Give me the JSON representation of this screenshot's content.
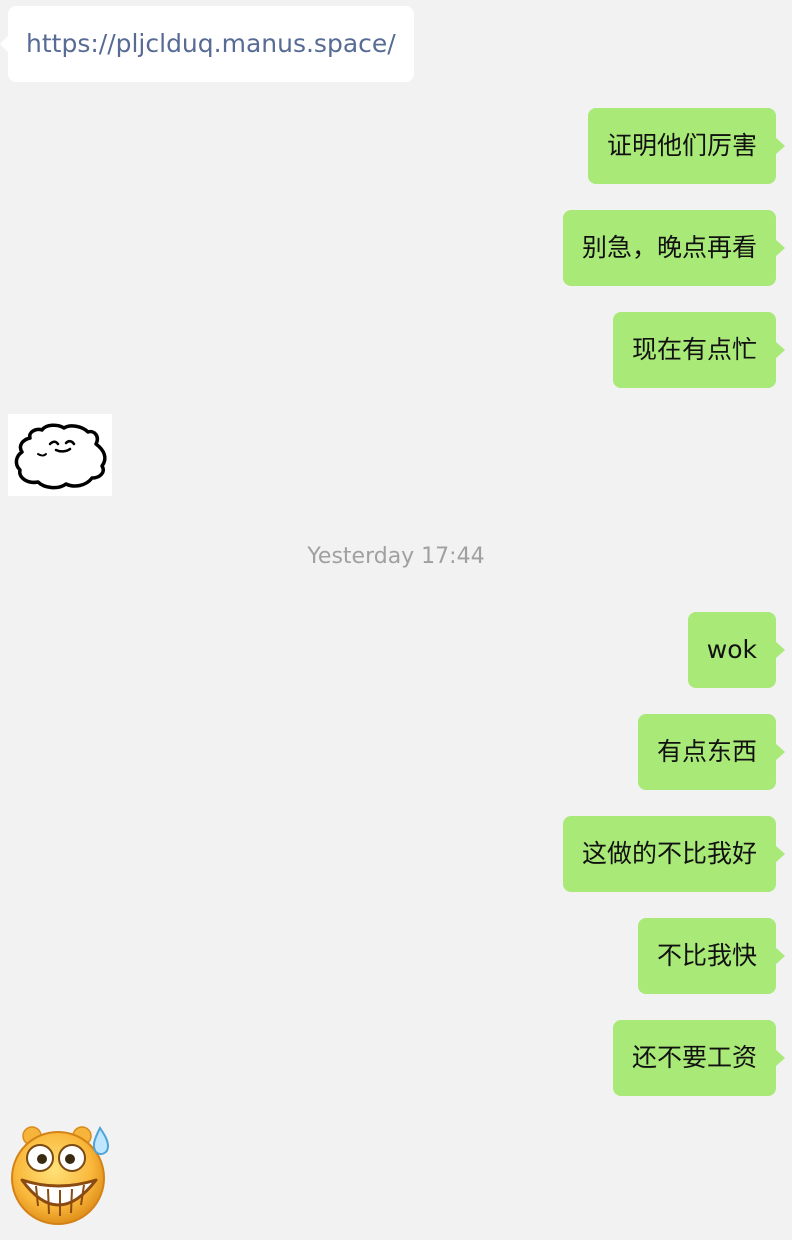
{
  "messages": [
    {
      "side": "in",
      "type": "link",
      "text": "https://pljclduq.manus.space/"
    },
    {
      "side": "out",
      "type": "text",
      "text": "证明他们厉害"
    },
    {
      "side": "out",
      "type": "text",
      "text": "别急，晚点再看"
    },
    {
      "side": "out",
      "type": "text",
      "text": "现在有点忙"
    },
    {
      "side": "in",
      "type": "sticker",
      "icon": "blob-sticker-icon"
    },
    {
      "type": "timestamp",
      "text": "Yesterday 17:44"
    },
    {
      "side": "out",
      "type": "text",
      "text": "wok"
    },
    {
      "side": "out",
      "type": "text",
      "text": "有点东西"
    },
    {
      "side": "out",
      "type": "text",
      "text": "这做的不比我好"
    },
    {
      "side": "out",
      "type": "text",
      "text": "不比我快"
    },
    {
      "side": "out",
      "type": "text",
      "text": "还不要工资"
    },
    {
      "side": "in",
      "type": "sticker",
      "icon": "grin-sweat-emoji-icon"
    }
  ],
  "colors": {
    "background": "#f2f2f2",
    "incoming_bubble": "#ffffff",
    "outgoing_bubble": "#a9e978",
    "link": "#576b95",
    "timestamp": "#a0a0a0"
  }
}
